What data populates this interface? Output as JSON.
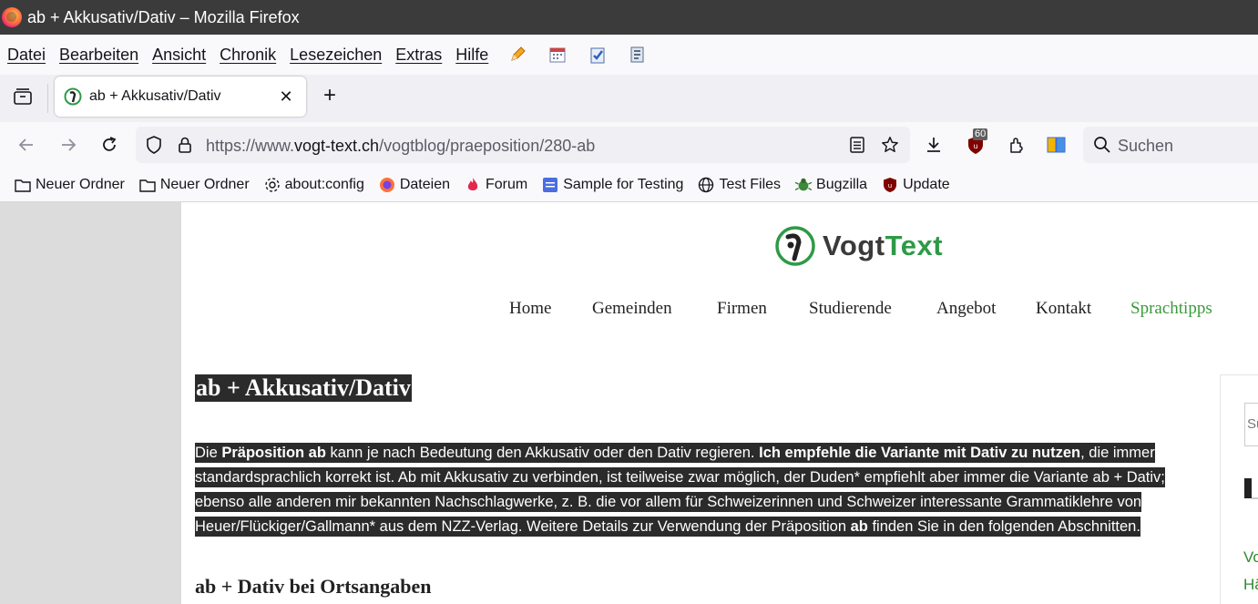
{
  "window": {
    "title": "ab + Akkusativ/Dativ – Mozilla Firefox"
  },
  "menu": {
    "items": [
      "Datei",
      "Bearbeiten",
      "Ansicht",
      "Chronik",
      "Lesezeichen",
      "Extras",
      "Hilfe"
    ],
    "tool_icons": [
      "pencil-icon",
      "calendar-icon",
      "clipboard-check-icon",
      "settings-doc-icon"
    ]
  },
  "tabs": {
    "active_title": "ab + Akkusativ/Dativ",
    "close_glyph": "✕",
    "new_tab_glyph": "+"
  },
  "navbar": {
    "url_prefix": "https://www.",
    "url_domain": "vogt-text.ch",
    "url_path": "/vogtblog/praeposition/280-ab",
    "search_placeholder": "Suchen",
    "ublock_badge": "60"
  },
  "bookmarks": [
    {
      "label": "Neuer Ordner",
      "icon": "folder-icon"
    },
    {
      "label": "Neuer Ordner",
      "icon": "folder-icon"
    },
    {
      "label": "about:config",
      "icon": "gear-icon"
    },
    {
      "label": "Dateien",
      "icon": "firefox-icon"
    },
    {
      "label": "Forum",
      "icon": "flame-icon"
    },
    {
      "label": "Sample for Testing",
      "icon": "doc-icon"
    },
    {
      "label": "Test Files",
      "icon": "globe-icon"
    },
    {
      "label": "Bugzilla",
      "icon": "bug-icon"
    },
    {
      "label": "Update",
      "icon": "ublock-icon"
    }
  ],
  "site": {
    "logo_vogt": "Vogt",
    "logo_text": "Text",
    "nav": [
      "Home",
      "Gemeinden",
      "Firmen",
      "Studierende",
      "Angebot",
      "Kontakt",
      "Sprachtipps"
    ],
    "active_nav": "Sprachtipps",
    "accent_color": "#3a9a3a"
  },
  "article": {
    "title": "ab + Akkusativ/Dativ",
    "p1_a": "Die ",
    "p1_b": "Präposition ab",
    "p1_c": " kann je nach Bedeutung den Akkusativ oder den Dativ regieren. ",
    "p1_d": "Ich empfehle die Variante mit Dativ zu nutzen",
    "p1_e": ", die immer standardsprachlich korrekt ist. Ab mit Akkusativ zu verbinden, ist teilweise zwar möglich, der Duden* empfiehlt aber immer die Variante ab + Dativ; ebenso alle anderen mir bekannten Nachschlagwerke, z. B. die vor allem für Schweizerinnen und Schweizer interessante Grammatiklehre von Heuer/Flückiger/Gallmann* aus dem NZZ-Verlag. Weitere Details zur Verwendung der Präposition ",
    "p1_f": "ab",
    "p1_g": " finden Sie in den folgenden Abschnitten.",
    "subheading": "ab + Dativ bei Ortsangaben"
  },
  "sidebar": {
    "search_fragment": "Su",
    "link1": "Vo",
    "link2": "Hä"
  }
}
